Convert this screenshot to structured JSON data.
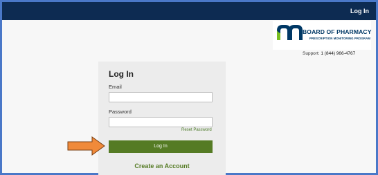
{
  "topbar": {
    "login_link": "Log In"
  },
  "logo": {
    "title": "BOARD OF PHARMACY",
    "subtitle": "PRESCRIPTION MONITORING PROGRAM",
    "mark_color": "#003865"
  },
  "support": {
    "label": "Support:",
    "phone": "1 (844) 966-4767"
  },
  "login_form": {
    "title": "Log In",
    "email_label": "Email",
    "email_value": "",
    "password_label": "Password",
    "password_value": "",
    "reset_link": "Reset Password",
    "submit_label": "Log In",
    "create_account_link": "Create an Account"
  },
  "annotation": {
    "arrow_color": "#f08a3a",
    "arrow_points_to": "login-button"
  },
  "colors": {
    "topbar": "#0d2b52",
    "accent_green": "#557b24",
    "frame_border": "#4a78c8"
  }
}
